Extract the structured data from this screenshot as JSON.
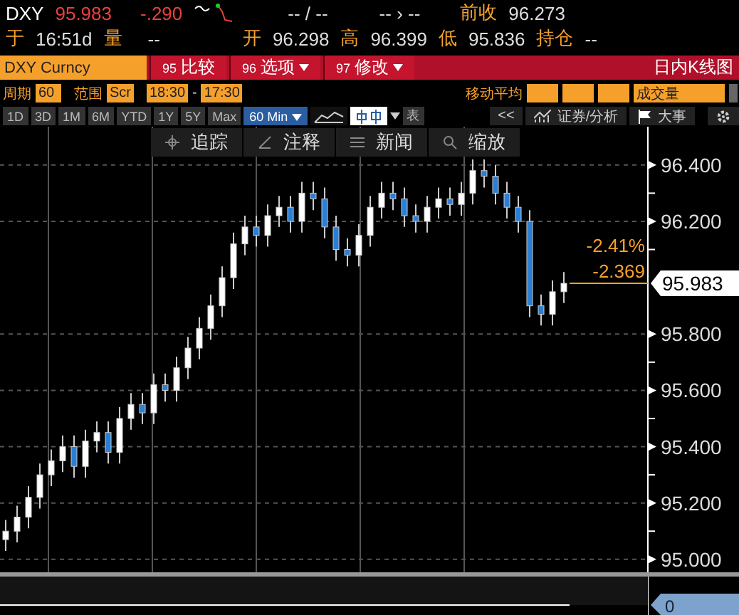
{
  "quote": {
    "symbol": "DXY",
    "last": "95.983",
    "change": "-.290",
    "bid_ask": "-- / --",
    "size": "-- › --",
    "prev_close_label": "前收",
    "prev_close": "96.273",
    "time_label": "于",
    "time": "16:51d",
    "volume_label": "量",
    "volume": "--",
    "open_label": "开",
    "open": "96.298",
    "high_label": "高",
    "high": "96.399",
    "low_label": "低",
    "low": "95.836",
    "oi_label": "持仓",
    "oi": "--"
  },
  "command_bar": {
    "ticker": "DXY Curncy",
    "buttons": [
      {
        "number": "95",
        "label": "比较",
        "dropdown": false
      },
      {
        "number": "96",
        "label": "选项",
        "dropdown": true
      },
      {
        "number": "97",
        "label": "修改",
        "dropdown": true
      }
    ],
    "title": "日内K线图"
  },
  "settings": {
    "period_label": "周期",
    "period": "60",
    "range_label": "范围",
    "range": "Scr",
    "start": "18:30",
    "separator": "-",
    "end": "17:30",
    "ma_label": "移动平均",
    "volume_field": "成交量"
  },
  "periods": [
    "1D",
    "3D",
    "1M",
    "6M",
    "YTD",
    "1Y",
    "5Y",
    "Max"
  ],
  "interval": "60 Min",
  "chart_types": [
    {
      "kind": "line",
      "selected": false
    },
    {
      "kind": "candle",
      "selected": true
    }
  ],
  "table_label": "表",
  "back": "<<",
  "analysis": "证券/分析",
  "events": "大事",
  "tools": [
    {
      "kind": "crosshair",
      "label": "追踪"
    },
    {
      "kind": "pen",
      "label": "注释"
    },
    {
      "kind": "news",
      "label": "新闻"
    },
    {
      "kind": "zoom",
      "label": "缩放"
    }
  ],
  "chart": {
    "last_price": "95.983",
    "change_pct": "-2.41%",
    "change": "-2.369",
    "volume_axis": "0",
    "chart_data": {
      "type": "candlestick",
      "grid": true,
      "ylim": [
        94.954,
        96.536
      ],
      "yticks": [
        {
          "value": 96.4,
          "label": "96.400"
        },
        {
          "value": 96.2,
          "label": "96.200"
        },
        {
          "value": 95.8,
          "label": "95.800"
        },
        {
          "value": 95.6,
          "label": "95.600"
        },
        {
          "value": 95.4,
          "label": "95.400"
        },
        {
          "value": 95.2,
          "label": "95.200"
        },
        {
          "value": 95.0,
          "label": "95.000"
        }
      ],
      "ohlc": [
        [
          95.07,
          95.14,
          95.03,
          95.1
        ],
        [
          95.1,
          95.19,
          95.06,
          95.15
        ],
        [
          95.15,
          95.26,
          95.11,
          95.22
        ],
        [
          95.22,
          95.34,
          95.18,
          95.3
        ],
        [
          95.3,
          95.39,
          95.26,
          95.35
        ],
        [
          95.35,
          95.44,
          95.31,
          95.4
        ],
        [
          95.4,
          95.44,
          95.29,
          95.33
        ],
        [
          95.33,
          95.46,
          95.29,
          95.42
        ],
        [
          95.42,
          95.49,
          95.38,
          95.45
        ],
        [
          95.45,
          95.49,
          95.34,
          95.38
        ],
        [
          95.38,
          95.54,
          95.34,
          95.5
        ],
        [
          95.5,
          95.59,
          95.46,
          95.55
        ],
        [
          95.55,
          95.59,
          95.48,
          95.52
        ],
        [
          95.52,
          95.66,
          95.48,
          95.62
        ],
        [
          95.62,
          95.66,
          95.56,
          95.6
        ],
        [
          95.6,
          95.72,
          95.56,
          95.68
        ],
        [
          95.68,
          95.79,
          95.64,
          95.75
        ],
        [
          95.75,
          95.86,
          95.71,
          95.82
        ],
        [
          95.82,
          95.94,
          95.78,
          95.9
        ],
        [
          95.9,
          96.04,
          95.86,
          96.0
        ],
        [
          96.0,
          96.16,
          95.96,
          96.12
        ],
        [
          96.12,
          96.22,
          96.08,
          96.18
        ],
        [
          96.18,
          96.22,
          96.11,
          96.15
        ],
        [
          96.15,
          96.26,
          96.11,
          96.22
        ],
        [
          96.22,
          96.29,
          96.18,
          96.25
        ],
        [
          96.25,
          96.29,
          96.16,
          96.2
        ],
        [
          96.2,
          96.34,
          96.16,
          96.3
        ],
        [
          96.3,
          96.34,
          96.24,
          96.28
        ],
        [
          96.28,
          96.32,
          96.14,
          96.18
        ],
        [
          96.18,
          96.22,
          96.06,
          96.1
        ],
        [
          96.1,
          96.14,
          96.04,
          96.08
        ],
        [
          96.08,
          96.19,
          96.04,
          96.15
        ],
        [
          96.15,
          96.29,
          96.11,
          96.25
        ],
        [
          96.25,
          96.34,
          96.21,
          96.3
        ],
        [
          96.3,
          96.34,
          96.24,
          96.28
        ],
        [
          96.28,
          96.32,
          96.18,
          96.22
        ],
        [
          96.22,
          96.26,
          96.16,
          96.2
        ],
        [
          96.2,
          96.29,
          96.16,
          96.25
        ],
        [
          96.25,
          96.32,
          96.21,
          96.28
        ],
        [
          96.28,
          96.32,
          96.22,
          96.26
        ],
        [
          96.26,
          96.34,
          96.22,
          96.3
        ],
        [
          96.3,
          96.42,
          96.26,
          96.38
        ],
        [
          96.38,
          96.42,
          96.32,
          96.36
        ],
        [
          96.36,
          96.4,
          96.26,
          96.3
        ],
        [
          96.3,
          96.34,
          96.21,
          96.25
        ],
        [
          96.25,
          96.29,
          96.16,
          96.2
        ],
        [
          96.2,
          96.24,
          95.86,
          95.9
        ],
        [
          95.9,
          95.94,
          95.83,
          95.87
        ],
        [
          95.87,
          95.99,
          95.83,
          95.95
        ],
        [
          95.95,
          96.02,
          95.91,
          95.98
        ]
      ]
    }
  }
}
